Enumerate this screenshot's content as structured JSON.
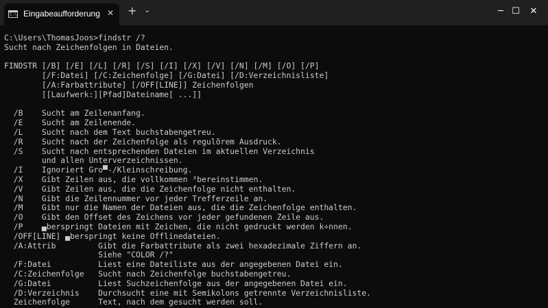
{
  "window": {
    "tab_title": "Eingabeaufforderung",
    "tab_icon_glyph": "C:\\",
    "close_tab_glyph": "✕",
    "new_tab_glyph": "+",
    "dropdown_glyph": "⌄",
    "minimize_glyph": "─",
    "maximize_glyph": "☐",
    "close_glyph": "✕"
  },
  "terminal": {
    "lines": [
      "C:\\Users\\ThomasJoos>findstr /?",
      "Sucht nach Zeichenfolgen in Dateien.",
      "",
      "FINDSTR [/B] [/E] [/L] [/R] [/S] [/I] [/X] [/V] [/N] [/M] [/O] [/P]",
      "        [/F:Datei] [/C:Zeichenfolge] [/G:Datei] [/D:Verzeichnisliste]",
      "        [/A:Farbattribute] [/OFF[LINE]] Zeichenfolgen",
      "        [[Laufwerk:][Pfad]Dateiname[ ...]]",
      "",
      "  /B    Sucht am Zeilenanfang.",
      "  /E    Sucht am Zeilenende.",
      "  /L    Sucht nach dem Text buchstabengetreu.",
      "  /R    Sucht nach der Zeichenfolge als regulõrem Ausdruck.",
      "  /S    Sucht nach entsprechenden Dateien im aktuellen Verzeichnis",
      "        und allen Unterverzeichnissen.",
      "  /I    Ignoriert Gro▀-/Kleinschreibung.",
      "  /X    Gibt Zeilen aus, die vollkommen ³bereinstimmen.",
      "  /V    Gibt Zeilen aus, die die Zeichenfolge nicht enthalten.",
      "  /N    Gibt die Zeilennummer vor jeder Trefferzeile an.",
      "  /M    Gibt nur die Namen der Dateien aus, die die Zeichenfolge enthalten.",
      "  /O    Gibt den Offset des Zeichens vor jeder gefundenen Zeile aus.",
      "  /P    ▄berspringt Dateien mit Zeichen, die nicht gedruckt werden k÷nnen.",
      "  /OFF[LINE] ▄berspringt keine Offlinedateien.",
      "  /A:Attrib         Gibt die Farbattribute als zwei hexadezimale Ziffern an.",
      "                    Siehe \"COLOR /?\"",
      "  /F:Datei          Liest eine Dateiliste aus der angegebenen Datei ein.",
      "  /C:Zeichenfolge   Sucht nach Zeichenfolge buchstabengetreu.",
      "  /G:Datei          Liest Suchzeichenfolge aus der angegebenen Datei ein.",
      "  /D:Verzeichnis    Durchsucht eine mit Semikolons getrennte Verzeichnisliste.",
      "  Zeichenfolge      Text, nach dem gesucht werden soll."
    ]
  }
}
